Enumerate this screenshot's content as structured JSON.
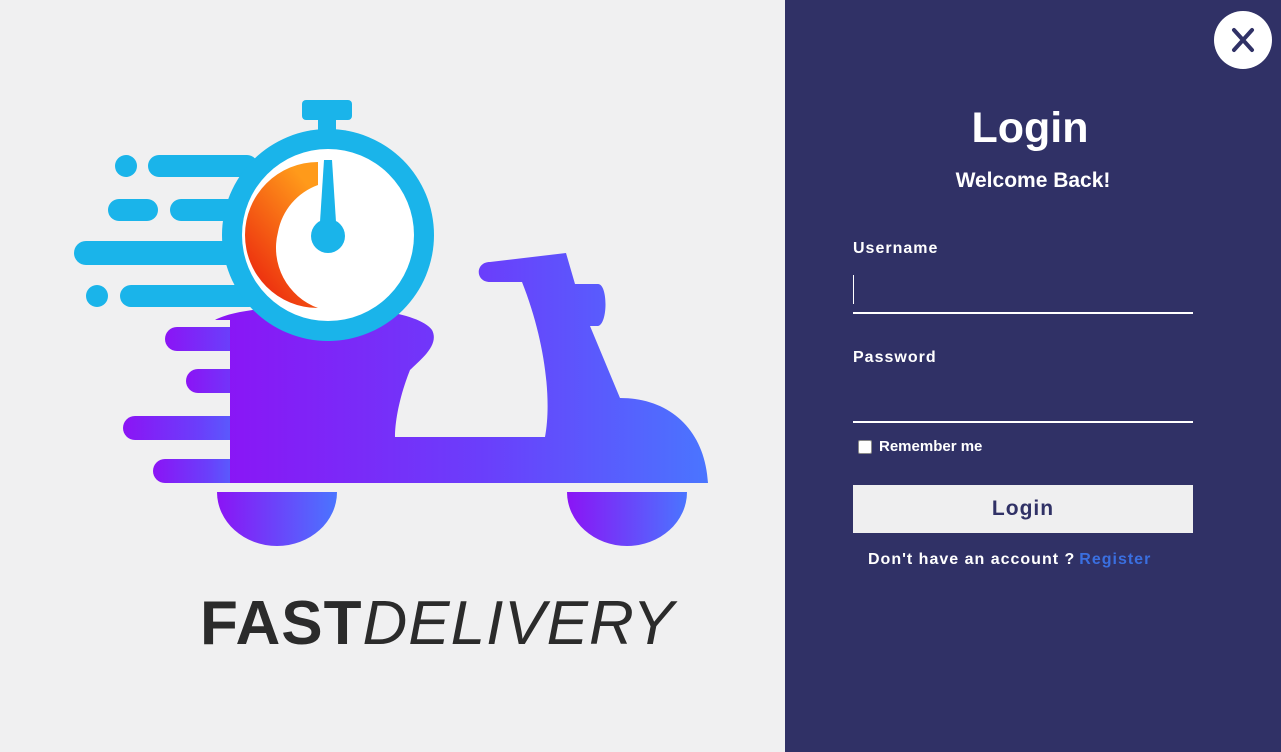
{
  "brand": {
    "part1": "FAST",
    "part2": "DELIVERY"
  },
  "login": {
    "title": "Login",
    "subtitle": "Welcome Back!",
    "username_label": "Username",
    "username_value": "",
    "password_label": "Password",
    "password_value": "",
    "remember_label": "Remember me",
    "remember_checked": false,
    "submit_label": "Login",
    "register_prompt": "Don't have an account ?",
    "register_link": "Register"
  },
  "icons": {
    "close": "close-icon",
    "logo": "scooter-stopwatch-logo"
  },
  "colors": {
    "panel_bg": "#303166",
    "left_bg": "#f0f0f1",
    "accent_link": "#3a6fe0",
    "logo_cyan": "#1ab4ea",
    "logo_purple": "#8b14f5",
    "logo_blue": "#4a75ff",
    "logo_orange": "#f56a10"
  }
}
